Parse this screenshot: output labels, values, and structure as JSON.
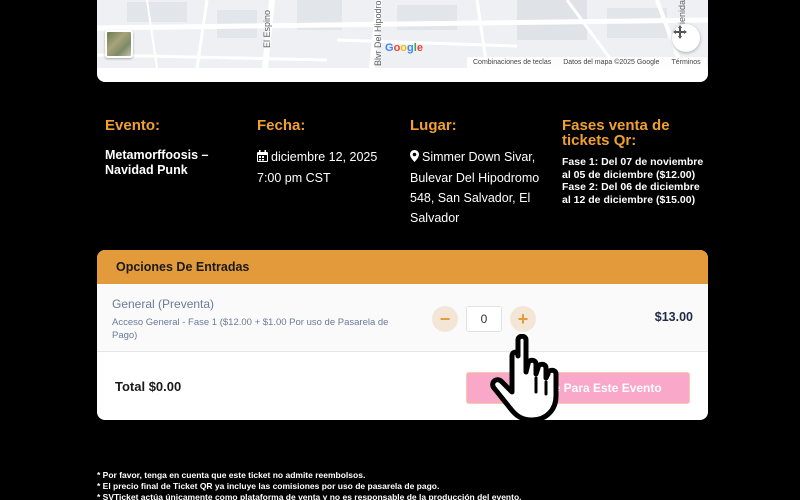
{
  "map": {
    "streets": [
      "El Espino",
      "Blvr Del Hipodromo",
      "ienida"
    ],
    "google_logo": [
      "G",
      "o",
      "o",
      "g",
      "l",
      "e"
    ],
    "google_colors": [
      "#4285F4",
      "#EA4335",
      "#FBBC05",
      "#4285F4",
      "#34A853",
      "#EA4335"
    ],
    "footer": {
      "shortcuts": "Combinaciones de teclas",
      "map_data": "Datos del mapa ©2025 Google",
      "terms": "Términos"
    }
  },
  "event": {
    "heading": "Evento:",
    "name": "Metamorffoosis – Navidad Punk"
  },
  "date": {
    "heading": "Fecha:",
    "date": "diciembre 12, 2025",
    "time": "7:00 pm CST"
  },
  "venue": {
    "heading": "Lugar:",
    "address": "Simmer Down Sivar, Bulevar Del Hipodromo 548, San Salvador, El Salvador"
  },
  "phases": {
    "heading": "Fases venta de tickets Qr:",
    "items": [
      "Fase 1:  Del 07 de noviembre al 05 de diciembre ($12.00)",
      "Fase 2: Del  06 de diciembre al 12 de diciembre ($15.00)"
    ]
  },
  "tickets": {
    "header": "Opciones De Entradas",
    "type": "General (Preventa)",
    "description": "Acceso General - Fase 1 ($12.00 + $1.00 Por uso de Pasarela de Pago)",
    "minus": "−",
    "plus": "+",
    "quantity": "0",
    "price": "$13.00",
    "total": "Total $0.00",
    "register": "Registrarse Para Este Evento"
  },
  "notes": [
    "* Por favor, tenga en cuenta que este ticket no admite reembolsos.",
    "* El precio final de Ticket QR ya incluye las comisiones por uso de pasarela de pago.",
    "* SVTicket actúa únicamente como plataforma de venta y no es responsable de la producción del evento."
  ],
  "colors": {
    "accent": "#f0a030",
    "header_bar": "#e39a3a",
    "register_button": "#f9a8c9",
    "background": "#000000"
  },
  "icons": [
    "calendar-icon",
    "map-pin-icon",
    "compass-icon",
    "hand-cursor-icon"
  ]
}
